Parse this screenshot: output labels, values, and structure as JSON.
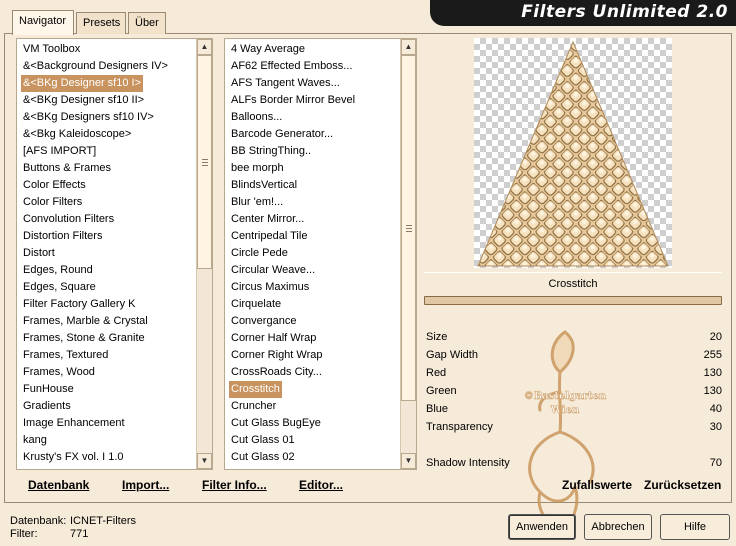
{
  "app": {
    "title": "Filters Unlimited 2.0"
  },
  "tabs": [
    {
      "label": "Navigator",
      "active": true
    },
    {
      "label": "Presets",
      "active": false
    },
    {
      "label": "Über",
      "active": false
    }
  ],
  "categories": {
    "items": [
      "VM Toolbox",
      "&<Background Designers IV>",
      "&<BKg Designer sf10 I>",
      "&<BKg Designer sf10 II>",
      "&<BKg Designers sf10 IV>",
      "&<Bkg Kaleidoscope>",
      "[AFS IMPORT]",
      "Buttons & Frames",
      "Color Effects",
      "Color Filters",
      "Convolution Filters",
      "Distortion Filters",
      "Distort",
      "Edges, Round",
      "Edges, Square",
      "Filter Factory Gallery K",
      "Frames, Marble & Crystal",
      "Frames, Stone & Granite",
      "Frames, Textured",
      "Frames, Wood",
      "FunHouse",
      "Gradients",
      "Image Enhancement",
      "kang",
      "Krusty's FX vol. I 1.0"
    ],
    "selected_index": 2
  },
  "filters": {
    "items": [
      "4 Way Average",
      "AF62 Effected Emboss...",
      "AFS Tangent Waves...",
      "ALFs Border Mirror Bevel",
      "Balloons...",
      "Barcode Generator...",
      "BB StringThing..",
      "bee morph",
      "BlindsVertical",
      "Blur 'em!...",
      "Center Mirror...",
      "Centripedal Tile",
      "Circle Pede",
      "Circular Weave...",
      "Circus Maximus",
      "Cirquelate",
      "Convergance",
      "Corner Half Wrap",
      "Corner Right Wrap",
      "CrossRoads City...",
      "Crosstitch",
      "Cruncher",
      "Cut Glass  BugEye",
      "Cut Glass 01",
      "Cut Glass 02"
    ],
    "selected_index": 20
  },
  "preview": {
    "filter_name": "Crosstitch"
  },
  "params": [
    {
      "label": "Size",
      "value": "20"
    },
    {
      "label": "Gap Width",
      "value": "255"
    },
    {
      "label": "Red",
      "value": "130"
    },
    {
      "label": "Green",
      "value": "130"
    },
    {
      "label": "Blue",
      "value": "40"
    },
    {
      "label": "Transparency",
      "value": "30"
    },
    {
      "label": "Shadow Intensity",
      "value": "70"
    }
  ],
  "links": {
    "database": "Datenbank",
    "import": "Import...",
    "filter_info": "Filter Info...",
    "editor": "Editor...",
    "random": "Zufallswerte",
    "reset": "Zurücksetzen"
  },
  "footer": {
    "database_label": "Datenbank:",
    "database_value": "ICNET-Filters",
    "filter_label": "Filter:",
    "filter_value": "771"
  },
  "buttons": {
    "apply": "Anwenden",
    "cancel": "Abbrechen",
    "help": "Hilfe"
  },
  "watermark": {
    "line1": "©Bastelgarten",
    "line2": "Wien"
  },
  "colors": {
    "selection": "#c8935e",
    "background": "#f6ead9",
    "preview_tint": "#e8c99c"
  }
}
